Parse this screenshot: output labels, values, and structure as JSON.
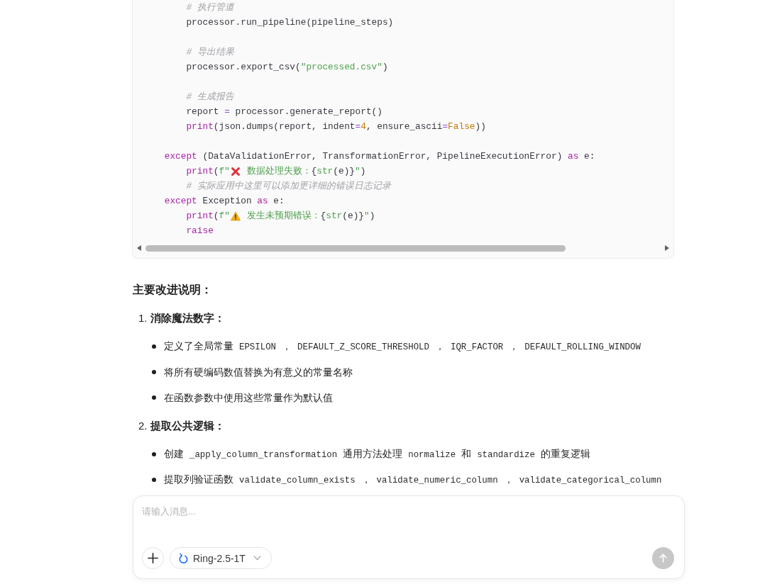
{
  "code_block": {
    "lines": [
      {
        "kind": "code",
        "tokens": [
          {
            "kind": "comment",
            "text": "        # 执行管道"
          }
        ]
      },
      {
        "kind": "code",
        "tokens": [
          {
            "kind": "plain",
            "text": "        processor.run_pipeline(pipeline_steps)"
          }
        ]
      },
      {
        "kind": "blank"
      },
      {
        "kind": "code",
        "tokens": [
          {
            "kind": "comment",
            "text": "        # 导出结果"
          }
        ]
      },
      {
        "kind": "code",
        "tokens": [
          {
            "kind": "plain",
            "text": "        processor.export_csv("
          },
          {
            "kind": "string",
            "text": "\"processed.csv\""
          },
          {
            "kind": "plain",
            "text": ")"
          }
        ]
      },
      {
        "kind": "blank"
      },
      {
        "kind": "code",
        "tokens": [
          {
            "kind": "comment",
            "text": "        # 生成报告"
          }
        ]
      },
      {
        "kind": "code",
        "tokens": [
          {
            "kind": "plain",
            "text": "        report "
          },
          {
            "kind": "operator",
            "text": "="
          },
          {
            "kind": "plain",
            "text": " processor.generate_report()"
          }
        ]
      },
      {
        "kind": "code",
        "tokens": [
          {
            "kind": "keyword",
            "text": "        print"
          },
          {
            "kind": "plain",
            "text": "(json.dumps(report, indent"
          },
          {
            "kind": "operator",
            "text": "="
          },
          {
            "kind": "number",
            "text": "4"
          },
          {
            "kind": "plain",
            "text": ", ensure_ascii"
          },
          {
            "kind": "operator",
            "text": "="
          },
          {
            "kind": "number",
            "text": "False"
          },
          {
            "kind": "plain",
            "text": "))"
          }
        ]
      },
      {
        "kind": "blank"
      },
      {
        "kind": "code",
        "tokens": [
          {
            "kind": "keyword",
            "text": "    except"
          },
          {
            "kind": "plain",
            "text": " (DataValidationError, TransformationError, PipelineExecutionError) "
          },
          {
            "kind": "keyword",
            "text": "as"
          },
          {
            "kind": "plain",
            "text": " e:"
          }
        ]
      },
      {
        "kind": "code",
        "tokens": [
          {
            "kind": "keyword",
            "text": "        print"
          },
          {
            "kind": "plain",
            "text": "("
          },
          {
            "kind": "string",
            "text": "f\""
          },
          {
            "kind": "cross_mark"
          },
          {
            "kind": "string",
            "text": " 数据处理失败："
          },
          {
            "kind": "plain",
            "text": "{"
          },
          {
            "kind": "builtin",
            "text": "str"
          },
          {
            "kind": "plain",
            "text": "(e)}"
          },
          {
            "kind": "string",
            "text": "\""
          },
          {
            "kind": "plain",
            "text": ")"
          }
        ]
      },
      {
        "kind": "code",
        "tokens": [
          {
            "kind": "comment",
            "text": "        # 实际应用中这里可以添加更详细的错误日志记录"
          }
        ]
      },
      {
        "kind": "code",
        "tokens": [
          {
            "kind": "keyword",
            "text": "    except"
          },
          {
            "kind": "plain",
            "text": " Exception "
          },
          {
            "kind": "keyword",
            "text": "as"
          },
          {
            "kind": "plain",
            "text": " e:"
          }
        ]
      },
      {
        "kind": "code",
        "tokens": [
          {
            "kind": "keyword",
            "text": "        print"
          },
          {
            "kind": "plain",
            "text": "("
          },
          {
            "kind": "string",
            "text": "f\""
          },
          {
            "kind": "warning_sign"
          },
          {
            "kind": "string",
            "text": " 发生未预期错误："
          },
          {
            "kind": "plain",
            "text": "{"
          },
          {
            "kind": "builtin",
            "text": "str"
          },
          {
            "kind": "plain",
            "text": "(e)}"
          },
          {
            "kind": "string",
            "text": "\""
          },
          {
            "kind": "plain",
            "text": ")"
          }
        ]
      },
      {
        "kind": "code",
        "tokens": [
          {
            "kind": "keyword",
            "text": "        raise"
          }
        ]
      }
    ]
  },
  "section_heading": "主要改进说明：",
  "improvements": [
    {
      "number": "1.",
      "title": "消除魔法数字：",
      "points": [
        {
          "parts": [
            {
              "kind": "text",
              "text": "定义了全局常量"
            },
            {
              "kind": "code",
              "text": "EPSILON"
            },
            {
              "kind": "text",
              "text": "，"
            },
            {
              "kind": "code",
              "text": "DEFAULT_Z_SCORE_THRESHOLD"
            },
            {
              "kind": "text",
              "text": "，"
            },
            {
              "kind": "code",
              "text": "IQR_FACTOR"
            },
            {
              "kind": "text",
              "text": "，"
            },
            {
              "kind": "code",
              "text": "DEFAULT_ROLLING_WINDOW"
            }
          ]
        },
        {
          "parts": [
            {
              "kind": "text",
              "text": "将所有硬编码数值替换为有意义的常量名称"
            }
          ]
        },
        {
          "parts": [
            {
              "kind": "text",
              "text": "在函数参数中使用这些常量作为默认值"
            }
          ]
        }
      ]
    },
    {
      "number": "2.",
      "title": "提取公共逻辑：",
      "points": [
        {
          "parts": [
            {
              "kind": "text",
              "text": "创建"
            },
            {
              "kind": "code",
              "text": "_apply_column_transformation"
            },
            {
              "kind": "text",
              "text": "通用方法处理"
            },
            {
              "kind": "code",
              "text": "normalize"
            },
            {
              "kind": "text",
              "text": "和"
            },
            {
              "kind": "code",
              "text": "standardize"
            },
            {
              "kind": "text",
              "text": "的重复逻辑"
            }
          ]
        },
        {
          "parts": [
            {
              "kind": "text",
              "text": "提取列验证函数"
            },
            {
              "kind": "code",
              "text": "validate_column_exists"
            },
            {
              "kind": "text",
              "text": "，"
            },
            {
              "kind": "code",
              "text": "validate_numeric_column"
            },
            {
              "kind": "text",
              "text": "，"
            },
            {
              "kind": "code",
              "text": "validate_categorical_column"
            }
          ]
        }
      ]
    }
  ],
  "composer": {
    "placeholder": "请输入消息...",
    "model_selector": {
      "label": "Ring-2.5-1T"
    },
    "send_button": {
      "disabled": true
    }
  }
}
